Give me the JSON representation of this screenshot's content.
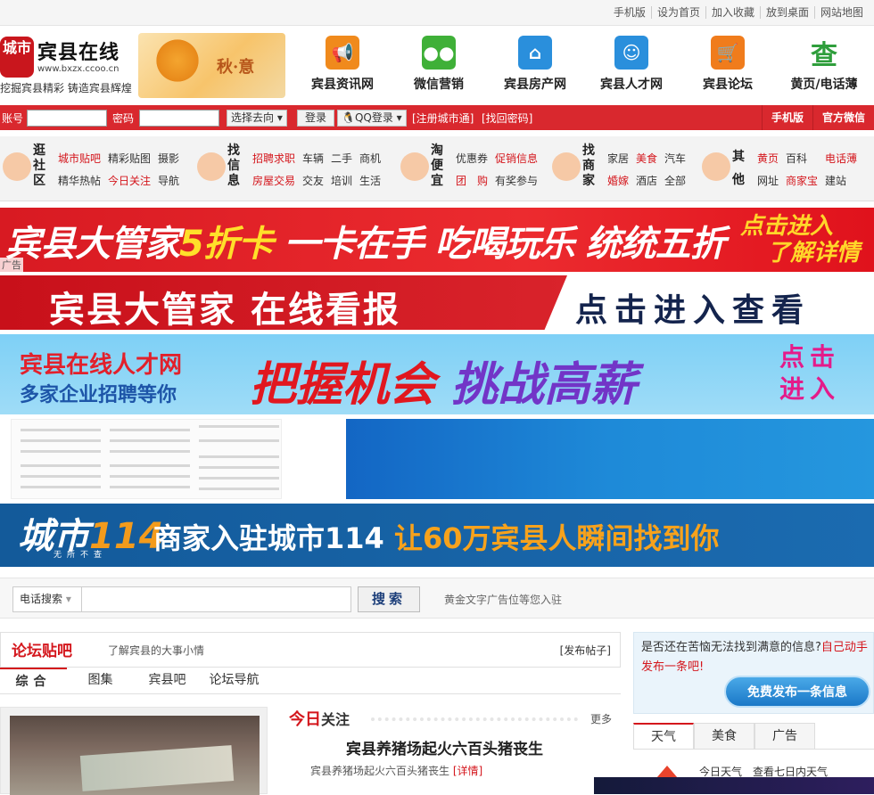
{
  "topbar": {
    "links": [
      "手机版",
      "设为首页",
      "加入收藏",
      "放到桌面",
      "网站地图"
    ]
  },
  "logo": {
    "badge": "城市",
    "name": "宾县在线",
    "url": "www.bxzx.ccoo.cn",
    "slogan": "挖掘宾县精彩 铸造宾县辉煌"
  },
  "season": {
    "text": "秋·意"
  },
  "nav": [
    {
      "label": "宾县资讯网",
      "icon": "megaphone-icon",
      "color": "#f08a1c"
    },
    {
      "label": "微信营销",
      "icon": "wechat-icon",
      "color": "#3fb038"
    },
    {
      "label": "宾县房产网",
      "icon": "house-icon",
      "color": "#2a8fdc"
    },
    {
      "label": "宾县人才网",
      "icon": "people-icon",
      "color": "#2a8fdc"
    },
    {
      "label": "宾县论坛",
      "icon": "cart-icon",
      "color": "#f07c1c"
    },
    {
      "label": "黄页/电话薄",
      "icon": "search-char-icon",
      "color": "#2f9e3c"
    }
  ],
  "login": {
    "account_label": "账号",
    "password_label": "密码",
    "goto_select": "选择去向",
    "login_button": "登录",
    "qq_button": "QQ登录",
    "register": "[注册城市通]",
    "forgot": "[找回密码]",
    "right": [
      "手机版",
      "官方微信"
    ]
  },
  "categories": [
    {
      "title": "逛社区",
      "items": [
        [
          "城市贴吧",
          "red"
        ],
        [
          "精彩贴图",
          ""
        ],
        [
          "摄影",
          ""
        ],
        [
          "精华热帖",
          ""
        ],
        [
          "今日关注",
          "red"
        ],
        [
          "导航",
          ""
        ]
      ]
    },
    {
      "title": "找信息",
      "items": [
        [
          "招聘求职",
          "red"
        ],
        [
          "车辆",
          ""
        ],
        [
          "二手",
          ""
        ],
        [
          "商机",
          ""
        ],
        [
          "房屋交易",
          "red"
        ],
        [
          "交友",
          ""
        ],
        [
          "培训",
          ""
        ],
        [
          "生活",
          ""
        ]
      ]
    },
    {
      "title": "淘便宜",
      "items": [
        [
          "优惠券",
          ""
        ],
        [
          "促销信息",
          "red"
        ],
        [
          "团　购",
          "red"
        ],
        [
          "有奖参与",
          ""
        ]
      ]
    },
    {
      "title": "找商家",
      "items": [
        [
          "家居",
          ""
        ],
        [
          "美食",
          "red"
        ],
        [
          "汽车",
          ""
        ],
        [
          "婚嫁",
          "red"
        ],
        [
          "酒店",
          ""
        ],
        [
          "全部",
          ""
        ]
      ]
    },
    {
      "title": "其他",
      "items": [
        [
          "黄页",
          "red"
        ],
        [
          "百科",
          ""
        ],
        [
          "电话薄",
          "red"
        ],
        [
          "网址",
          ""
        ],
        [
          "商家宝",
          "red"
        ],
        [
          "建站",
          ""
        ]
      ]
    }
  ],
  "banners": {
    "b1_main": "宾县大管家",
    "b1_accent": "5折卡",
    "b1_rest": " 一卡在手 吃喝玩乐 统统五折",
    "b1_cta1": "点击进入",
    "b1_cta2": "了解详情",
    "ad_tag": "广告",
    "b2_left": "宾县大管家 在线看报",
    "b2_right": "点击进入查看",
    "b3_a": "宾县在线人才网",
    "b3_b": "多家企业招聘等你",
    "b3_c1": "把握机会",
    "b3_c2": "挑战高薪",
    "b3_d1": "点击",
    "b3_d2": "进入",
    "b5_logo": "城市",
    "b5_logo_num": "114",
    "b5_sub": "无所不查",
    "b5_t1": "商家入驻城市114",
    "b5_t2": "让60万宾县人瞬间找到你"
  },
  "search": {
    "select": "电话搜索",
    "button": "搜索",
    "hint": "黄金文字广告位等您入驻"
  },
  "forum": {
    "title": "论坛贴吧",
    "desc": "了解宾县的大事小情",
    "post": "[发布帖子]",
    "tabs": [
      "综合",
      "图集",
      "宾县吧",
      "论坛导航"
    ]
  },
  "today": {
    "h1": "今日",
    "h2": "关注",
    "more": "更多",
    "headline": "宾县养猪场起火六百头猪丧生",
    "summary": "宾县养猪场起火六百头猪丧生",
    "detail": "[详情]"
  },
  "side": {
    "q1": "是否还在苦恼无法找到满意的信息?",
    "q2": "自己动手发布一条吧!",
    "button": "免费发布一条信息"
  },
  "wtabs": [
    "天气",
    "美食",
    "广告"
  ],
  "weather": {
    "today": "今日天气",
    "week": "查看七日内天气"
  }
}
